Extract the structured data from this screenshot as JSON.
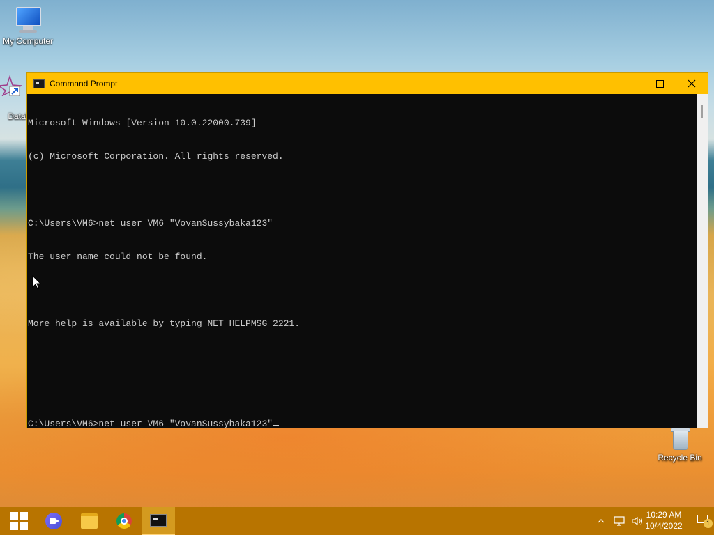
{
  "desktop": {
    "icons": [
      {
        "label": "My Computer"
      },
      {
        "label": "DataW"
      },
      {
        "label": "Recycle Bin"
      }
    ]
  },
  "window": {
    "title": "Command Prompt",
    "buttons": {
      "minimize": "—",
      "maximize": "□",
      "close": "✕"
    }
  },
  "console": {
    "lines": [
      "Microsoft Windows [Version 10.0.22000.739]",
      "(c) Microsoft Corporation. All rights reserved.",
      "",
      "C:\\Users\\VM6>net user VM6 \"VovanSussybaka123\"",
      "The user name could not be found.",
      "",
      "More help is available by typing NET HELPMSG 2221.",
      "",
      "",
      "C:\\Users\\VM6>net user VM6 \"VovanSussybaka123\""
    ]
  },
  "taskbar": {
    "items": [
      "start-button",
      "meet-button",
      "file-explorer-button",
      "chrome-button",
      "command-prompt-button"
    ],
    "tray": {
      "time": "10:29 AM",
      "date": "10/4/2022",
      "notification_count": "1"
    }
  },
  "colors": {
    "titlebar": "#ffc000",
    "taskbar": "#b87400",
    "console_bg": "#0c0c0c",
    "console_fg": "#cccccc"
  }
}
